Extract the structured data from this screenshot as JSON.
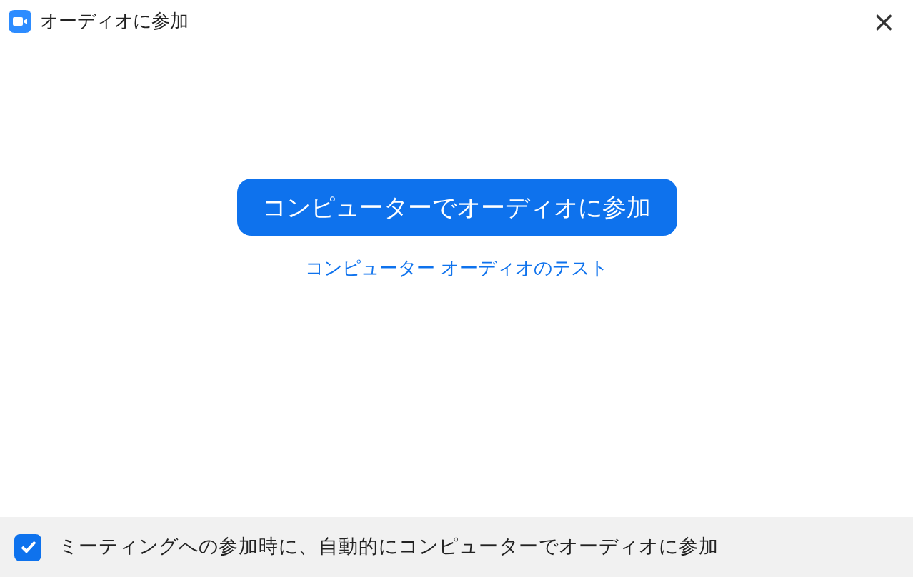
{
  "window": {
    "title": "オーディオに参加",
    "close": "×"
  },
  "join_button": "コンピューターでオーディオに参加",
  "test_link": "コンピューター オーディオのテスト",
  "auto_join": {
    "label": "ミーティングへの参加時に、自動的にコンピューターでオーディオに参加",
    "checked": true
  }
}
